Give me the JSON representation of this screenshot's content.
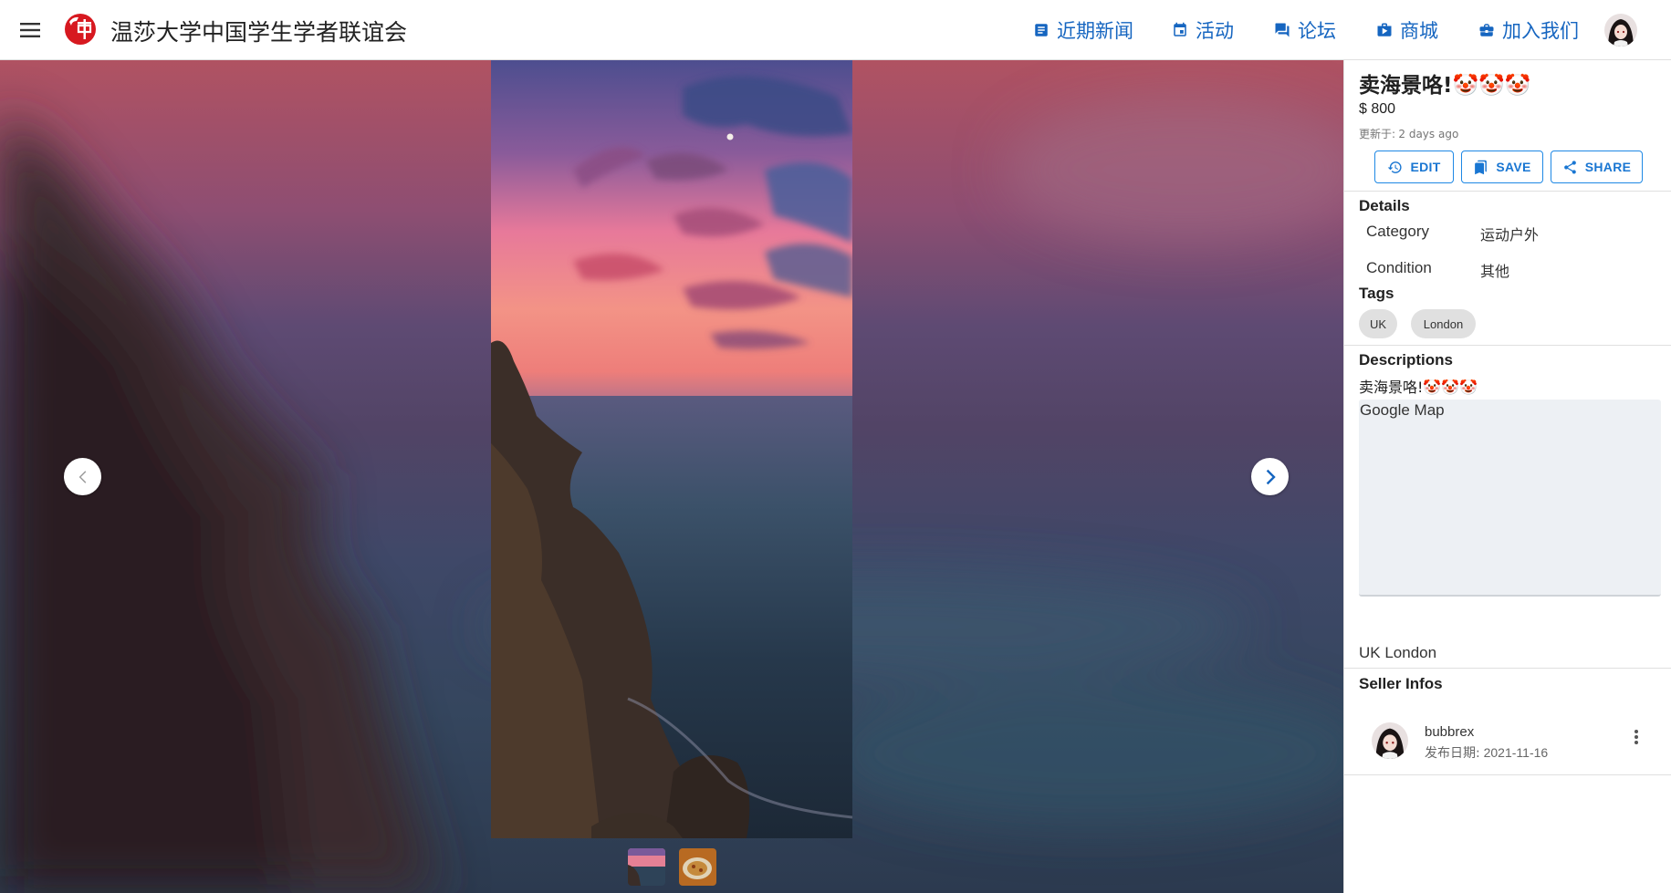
{
  "header": {
    "site_title": "温莎大学中国学生学者联谊会",
    "nav": [
      {
        "label": "近期新闻",
        "icon": "news-icon"
      },
      {
        "label": "活动",
        "icon": "calendar-icon"
      },
      {
        "label": "论坛",
        "icon": "forum-icon"
      },
      {
        "label": "商城",
        "icon": "shop-icon"
      },
      {
        "label": "加入我们",
        "icon": "briefcase-icon"
      }
    ],
    "accent_color": "#1565c0",
    "logo_color": "#d71920"
  },
  "gallery": {
    "thumbnails": [
      "sunset-sea-thumbnail",
      "food-thumbnail"
    ]
  },
  "listing": {
    "title": "卖海景咯!🤡🤡🤡",
    "price": "$ 800",
    "updated_label": "更新于:",
    "updated_value": "2 days ago",
    "actions": {
      "edit": "EDIT",
      "save": "SAVE",
      "share": "SHARE"
    },
    "details": {
      "heading": "Details",
      "category_label": "Category",
      "category_value": "运动户外",
      "condition_label": "Condition",
      "condition_value": "其他"
    },
    "tags": {
      "heading": "Tags",
      "items": [
        "UK",
        "London"
      ]
    },
    "descriptions": {
      "heading": "Descriptions",
      "text": "卖海景咯!🤡🤡🤡",
      "map_label": "Google Map",
      "location": "UK London"
    },
    "seller": {
      "heading": "Seller Infos",
      "name": "bubbrex",
      "date_label": "发布日期:",
      "date_value": "2021-11-16"
    }
  }
}
